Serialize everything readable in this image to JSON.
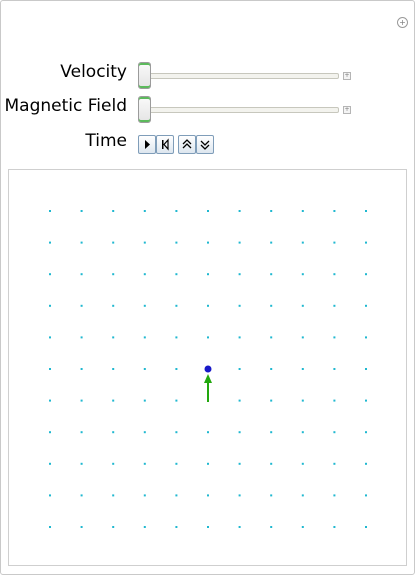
{
  "controls": {
    "velocity_label": "Velocity",
    "velocity_value": 0,
    "magnetic_field_label": "Magnetic Field",
    "magnetic_field_value": 0,
    "time_label": "Time"
  },
  "animator_buttons": [
    "play-icon",
    "step-back-icon",
    "faster-icon",
    "slower-icon"
  ],
  "colors": {
    "grid_dot": "#1fb8d0",
    "particle": "#1818c8",
    "velocity_arrow": "#22a80e",
    "slider_accent": "#5cba5c"
  }
}
